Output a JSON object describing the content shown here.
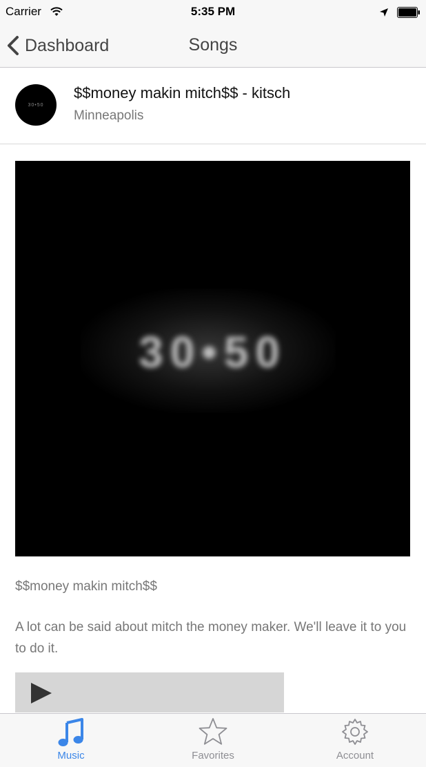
{
  "status_bar": {
    "carrier": "Carrier",
    "time": "5:35 PM"
  },
  "nav": {
    "back_label": "Dashboard",
    "title": "Songs"
  },
  "artist": {
    "title": "$$money makin mitch$$ - kitsch",
    "city": "Minneapolis",
    "avatar_text": "30•50"
  },
  "artwork": {
    "text": "30•50"
  },
  "song": {
    "name": "$$money makin mitch$$",
    "description": "A lot can be said about mitch the money maker. We'll leave it to you to do it."
  },
  "tabs": [
    {
      "label": "Music",
      "icon": "music-note-icon",
      "active": true
    },
    {
      "label": "Favorites",
      "icon": "star-icon",
      "active": false
    },
    {
      "label": "Account",
      "icon": "gear-icon",
      "active": false
    }
  ],
  "colors": {
    "accent": "#3b86e8",
    "bar_bg": "#f7f7f7",
    "player_bg": "#d6d6d6"
  }
}
